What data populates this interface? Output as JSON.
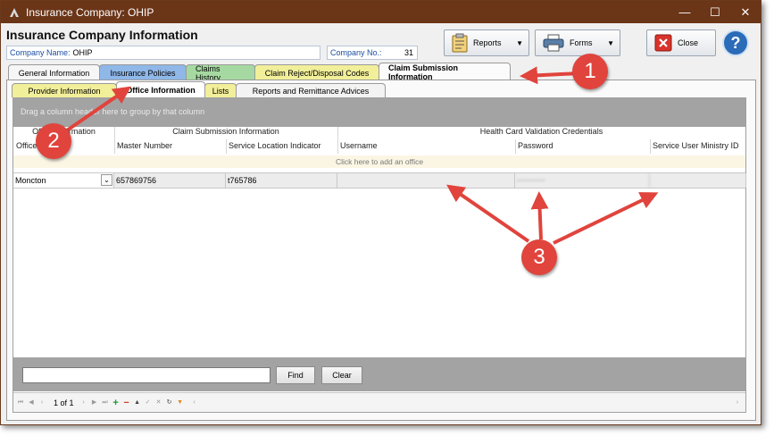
{
  "window": {
    "title": "Insurance Company:  OHIP",
    "minimize": "—",
    "maximize": "☐",
    "close": "✕"
  },
  "header": {
    "page_title": "Insurance Company Information",
    "company_name_label": "Company Name:",
    "company_name_value": "OHIP",
    "company_no_label": "Company No.:",
    "company_no_value": "31"
  },
  "toolbar": {
    "reports_label": "Reports",
    "forms_label": "Forms",
    "close_label": "Close",
    "help_label": "?"
  },
  "main_tabs": [
    {
      "label": "General Information"
    },
    {
      "label": "Insurance Policies"
    },
    {
      "label": "Claims History"
    },
    {
      "label": "Claim Reject/Disposal Codes"
    },
    {
      "label": "Claim Submission Information"
    }
  ],
  "sub_tabs": [
    {
      "label": "Provider Information"
    },
    {
      "label": "Office Information"
    },
    {
      "label": "Lists"
    },
    {
      "label": "Reports and Remittance Advices"
    }
  ],
  "grid": {
    "group_hint": "Drag a column header here to group by that column",
    "band_office": "Office Information",
    "band_claim": "Claim Submission Information",
    "band_health": "Health Card Validation Credentials",
    "columns": [
      "Office",
      "Master Number",
      "Service Location Indicator",
      "Username",
      "Password",
      "Service User Ministry ID"
    ],
    "add_row_text": "Click here to add an office",
    "rows": [
      {
        "office": "Moncton",
        "master_number": "657869756",
        "sli": "t765786",
        "username": "",
        "password": "••••••••••",
        "ministry_id": ""
      }
    ]
  },
  "find": {
    "find_label": "Find",
    "clear_label": "Clear"
  },
  "navigator": {
    "page_label": "1 of 1"
  },
  "annotations": [
    "1",
    "2",
    "3"
  ],
  "colors": {
    "titlebar": "#6b3518",
    "callout": "#e0443c",
    "accent_blue": "#1a4ea1"
  }
}
